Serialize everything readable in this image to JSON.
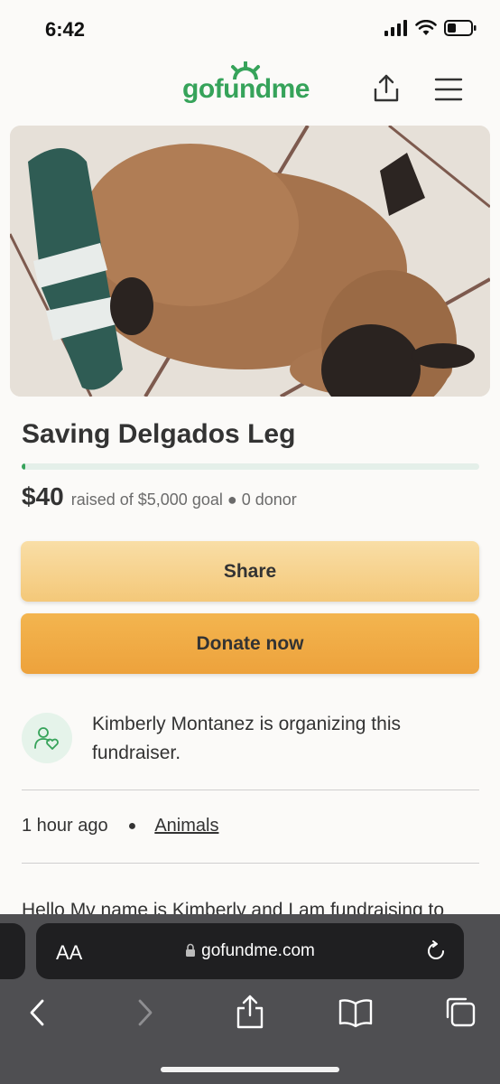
{
  "status": {
    "time": "6:42"
  },
  "header": {
    "logo": "gofundme"
  },
  "campaign": {
    "title": "Saving Delgados Leg",
    "amount_raised": "$40",
    "goal_text": "raised of $5,000 goal ● 0 donor",
    "progress_fraction": 0.008
  },
  "actions": {
    "share_label": "Share",
    "donate_label": "Donate now"
  },
  "organizer": {
    "text": "Kimberly Montanez is organizing this fundraiser."
  },
  "meta": {
    "time_ago": "1 hour ago",
    "category": "Animals"
  },
  "story": {
    "preview": "Hello My name is Kimberly and I am fundraising to"
  },
  "browser": {
    "aa_label": "AA",
    "url": "gofundme.com"
  },
  "colors": {
    "brand_green": "#36a35a",
    "share_button": "#f7d491",
    "donate_button": "#f0ab45"
  }
}
